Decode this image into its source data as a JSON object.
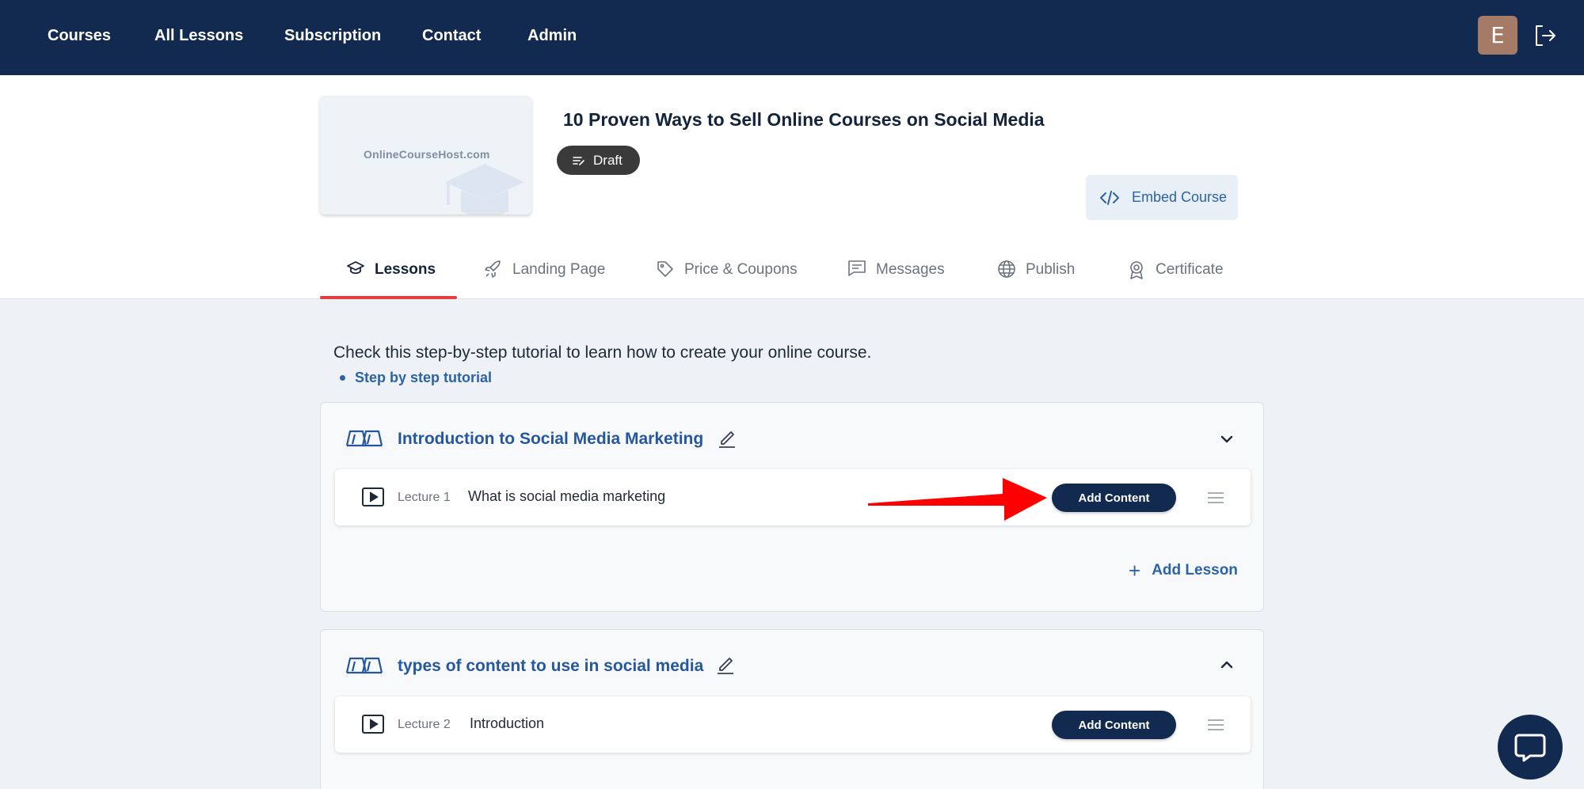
{
  "nav": {
    "items": [
      "Courses",
      "All Lessons",
      "Subscription",
      "Contact",
      "Admin"
    ],
    "avatar_initial": "E"
  },
  "course": {
    "title": "10 Proven Ways to Sell Online Courses on Social Media",
    "status": "Draft",
    "thumbnail_text": "OnlineCourseHost.com",
    "embed_label": "Embed Course"
  },
  "tabs": [
    "Lessons",
    "Landing Page",
    "Price & Coupons",
    "Messages",
    "Publish",
    "Certificate"
  ],
  "active_tab": "Lessons",
  "tutorial": {
    "text": "Check this step-by-step tutorial to learn how to create your online course.",
    "link": "Step by step tutorial"
  },
  "chapters": [
    {
      "title": "Introduction to Social Media Marketing",
      "expanded": true,
      "lessons": [
        {
          "number": "Lecture 1",
          "title": "What is social media marketing",
          "action": "Add Content"
        }
      ],
      "add_lesson_label": "Add Lesson"
    },
    {
      "title": "types of content to use in social media",
      "expanded": true,
      "lessons": [
        {
          "number": "Lecture 2",
          "title": "Introduction",
          "action": "Add Content"
        }
      ]
    }
  ],
  "colors": {
    "nav_bg": "#122a50",
    "accent_blue": "#2b63a8",
    "tab_active_underline": "#e53e3e",
    "annotation_arrow": "#ff0000"
  }
}
